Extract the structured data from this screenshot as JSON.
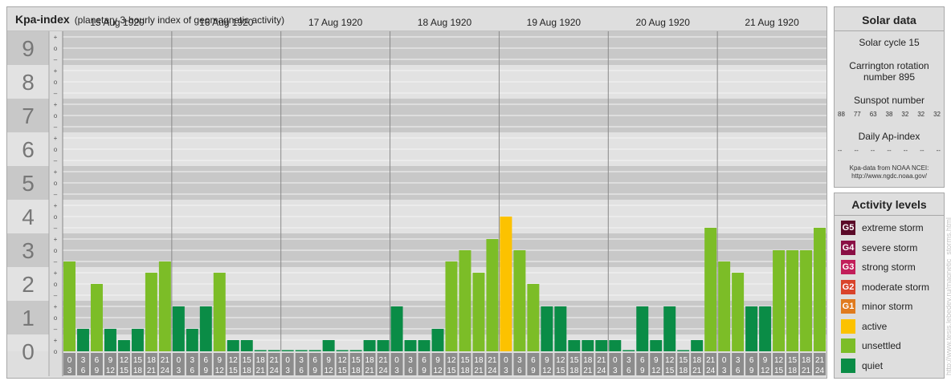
{
  "header": {
    "title": "Kpa-index",
    "subtitle": "(planetary 3-hourly index of geomagnetic activity)"
  },
  "chart_data": {
    "type": "bar",
    "title": "Kpa-index",
    "ylim": [
      0,
      9
    ],
    "y_ticks": [
      "0",
      "1",
      "2",
      "3",
      "4",
      "5",
      "6",
      "7",
      "8",
      "9"
    ],
    "minor_tick_labels": [
      "o",
      "+",
      "–"
    ],
    "days": [
      "15 Aug 1920",
      "16 Aug 1920",
      "17 Aug 1920",
      "18 Aug 1920",
      "19 Aug 1920",
      "20 Aug 1920",
      "21 Aug 1920"
    ],
    "interval_labels": [
      [
        "0",
        "3"
      ],
      [
        "3",
        "6"
      ],
      [
        "6",
        "9"
      ],
      [
        "9",
        "12"
      ],
      [
        "12",
        "15"
      ],
      [
        "15",
        "18"
      ],
      [
        "18",
        "21"
      ],
      [
        "21",
        "24"
      ]
    ],
    "values": [
      [
        2.667,
        0.667,
        2.0,
        0.667,
        0.333,
        0.667,
        2.333,
        2.667
      ],
      [
        1.333,
        0.667,
        1.333,
        2.333,
        0.333,
        0.333,
        0.0,
        0.0
      ],
      [
        0.0,
        0.0,
        0.0,
        0.333,
        0.0,
        0.0,
        0.333,
        0.333
      ],
      [
        1.333,
        0.333,
        0.333,
        0.667,
        2.667,
        3.0,
        2.333,
        3.333
      ],
      [
        4.0,
        3.0,
        2.0,
        1.333,
        1.333,
        0.333,
        0.333,
        0.333
      ],
      [
        0.333,
        0.0,
        1.333,
        0.333,
        1.333,
        0.0,
        0.333,
        3.667
      ],
      [
        2.667,
        2.333,
        1.333,
        1.333,
        3.0,
        3.0,
        3.0,
        3.667
      ]
    ],
    "colors": {
      "quiet": "#0a8c46",
      "unsettled": "#7cbd27",
      "active": "#fcc200",
      "minor_storm": "#e07b1e",
      "moderate_storm": "#d9432b",
      "strong_storm": "#c21e5a",
      "severe_storm": "#8a0f45",
      "extreme_storm": "#5a0a28"
    },
    "grid": true
  },
  "solar": {
    "heading": "Solar data",
    "cycle": "Solar cycle 15",
    "carrington_line1": "Carrington rotation",
    "carrington_line2": "number 895",
    "sunspot_heading": "Sunspot number",
    "sunspot_numbers": [
      "88",
      "77",
      "63",
      "38",
      "32",
      "32",
      "32"
    ],
    "ap_heading": "Daily Ap-index",
    "ap_values": [
      "--",
      "--",
      "--",
      "--",
      "--",
      "--",
      "--"
    ],
    "source_line1": "Kpa-data from NOAA NCEI:",
    "source_line2": "http://www.ngdc.noaa.gov/"
  },
  "activity": {
    "heading": "Activity levels",
    "items": [
      {
        "code": "G5",
        "label": "extreme storm",
        "color": "#5a0a28"
      },
      {
        "code": "G4",
        "label": "severe storm",
        "color": "#8a0f45"
      },
      {
        "code": "G3",
        "label": "strong storm",
        "color": "#c21e5a"
      },
      {
        "code": "G2",
        "label": "moderate storm",
        "color": "#d9432b"
      },
      {
        "code": "G1",
        "label": "minor storm",
        "color": "#e07b1e"
      },
      {
        "code": "",
        "label": "active",
        "color": "#fcc200"
      },
      {
        "code": "",
        "label": "unsettled",
        "color": "#7cbd27"
      },
      {
        "code": "",
        "label": "quiet",
        "color": "#0a8c46"
      }
    ]
  },
  "watermark": "http://www.tesis.lebedev.ru/magnetic_storms.html"
}
